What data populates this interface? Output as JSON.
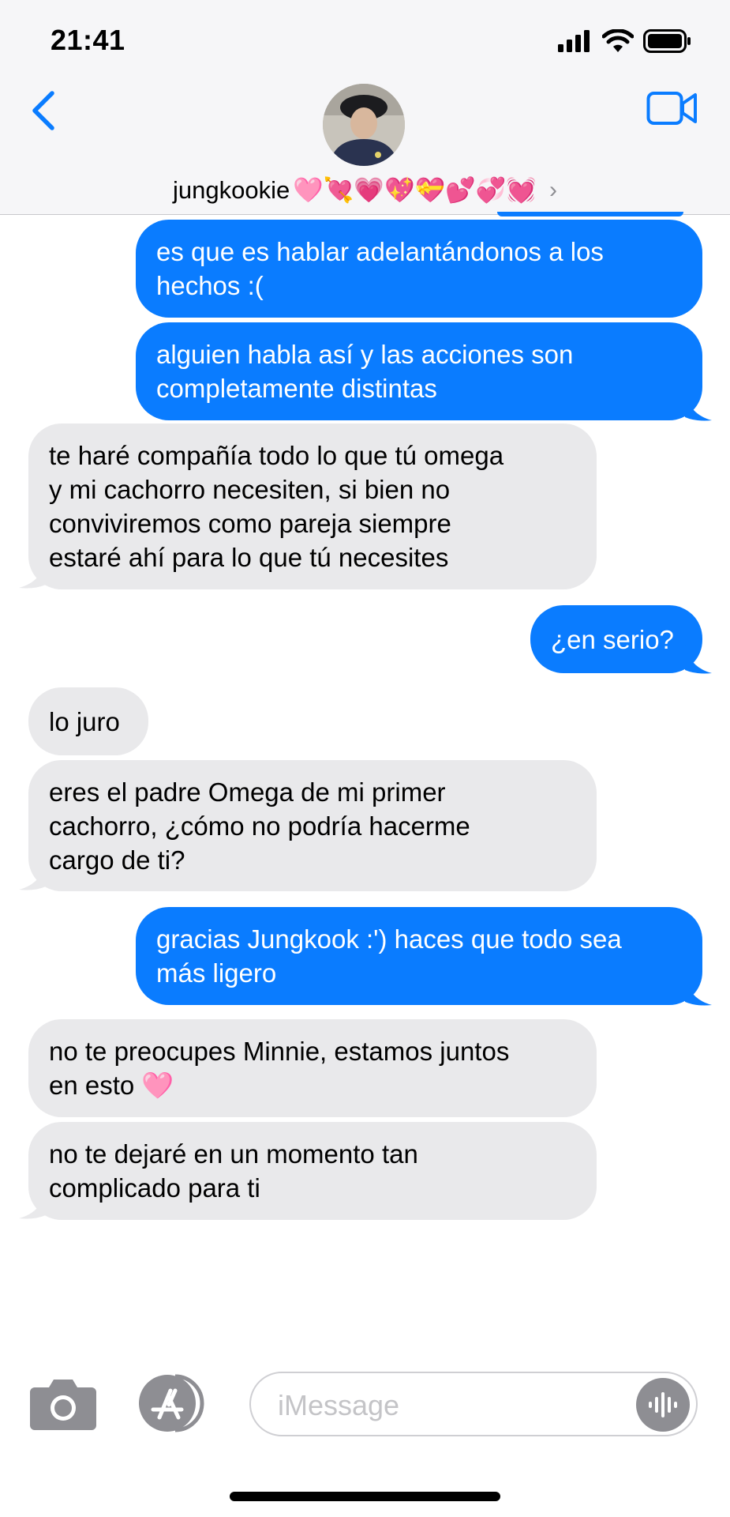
{
  "status_bar": {
    "time": "21:41"
  },
  "header": {
    "contact_name": "jungkookie",
    "contact_emojis": "🩷💘💗💖💝💕💞💓",
    "chevron": "›"
  },
  "messages": [
    {
      "sender": "me",
      "text": "es que es hablar adelantándonos a los\nhechos :("
    },
    {
      "sender": "me",
      "text": "alguien habla así y las acciones son\ncompletamente distintas"
    },
    {
      "sender": "them",
      "text": "te haré compañía todo lo que tú omega\ny mi cachorro necesiten, si bien no\nconviviremos como pareja siempre\nestaré ahí para lo que tú necesites"
    },
    {
      "sender": "me",
      "text": "¿en serio?"
    },
    {
      "sender": "them",
      "text": "lo juro"
    },
    {
      "sender": "them",
      "text": "eres el padre Omega de mi primer\ncachorro, ¿cómo no podría hacerme\ncargo de ti?"
    },
    {
      "sender": "me",
      "text": "gracias Jungkook :') haces que todo sea\nmás ligero"
    },
    {
      "sender": "them",
      "text": "no te preocupes Minnie, estamos juntos\nen esto 🩷"
    },
    {
      "sender": "them",
      "text": "no te dejaré en un momento tan\ncomplicado para ti"
    }
  ],
  "input_bar": {
    "placeholder": "iMessage"
  },
  "colors": {
    "outgoing": "#0a7cff",
    "incoming": "#e9e9eb",
    "accent": "#0a7cff"
  },
  "icons": [
    "back-chevron-icon",
    "video-call-icon",
    "camera-icon",
    "app-store-icon",
    "audio-waveform-icon",
    "signal-icon",
    "wifi-icon",
    "battery-icon"
  ]
}
